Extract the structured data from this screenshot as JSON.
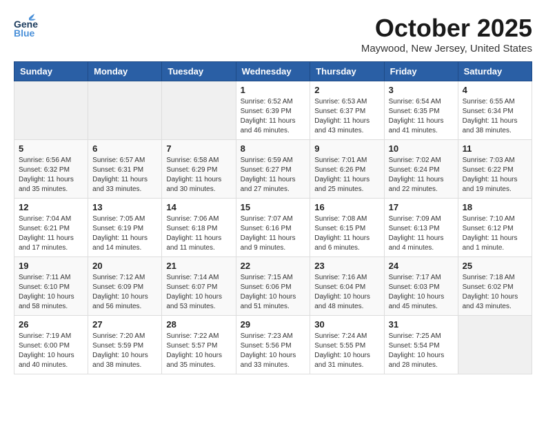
{
  "header": {
    "logo_general": "General",
    "logo_blue": "Blue",
    "month": "October 2025",
    "location": "Maywood, New Jersey, United States"
  },
  "weekdays": [
    "Sunday",
    "Monday",
    "Tuesday",
    "Wednesday",
    "Thursday",
    "Friday",
    "Saturday"
  ],
  "weeks": [
    [
      {
        "day": "",
        "info": ""
      },
      {
        "day": "",
        "info": ""
      },
      {
        "day": "",
        "info": ""
      },
      {
        "day": "1",
        "info": "Sunrise: 6:52 AM\nSunset: 6:39 PM\nDaylight: 11 hours\nand 46 minutes."
      },
      {
        "day": "2",
        "info": "Sunrise: 6:53 AM\nSunset: 6:37 PM\nDaylight: 11 hours\nand 43 minutes."
      },
      {
        "day": "3",
        "info": "Sunrise: 6:54 AM\nSunset: 6:35 PM\nDaylight: 11 hours\nand 41 minutes."
      },
      {
        "day": "4",
        "info": "Sunrise: 6:55 AM\nSunset: 6:34 PM\nDaylight: 11 hours\nand 38 minutes."
      }
    ],
    [
      {
        "day": "5",
        "info": "Sunrise: 6:56 AM\nSunset: 6:32 PM\nDaylight: 11 hours\nand 35 minutes."
      },
      {
        "day": "6",
        "info": "Sunrise: 6:57 AM\nSunset: 6:31 PM\nDaylight: 11 hours\nand 33 minutes."
      },
      {
        "day": "7",
        "info": "Sunrise: 6:58 AM\nSunset: 6:29 PM\nDaylight: 11 hours\nand 30 minutes."
      },
      {
        "day": "8",
        "info": "Sunrise: 6:59 AM\nSunset: 6:27 PM\nDaylight: 11 hours\nand 27 minutes."
      },
      {
        "day": "9",
        "info": "Sunrise: 7:01 AM\nSunset: 6:26 PM\nDaylight: 11 hours\nand 25 minutes."
      },
      {
        "day": "10",
        "info": "Sunrise: 7:02 AM\nSunset: 6:24 PM\nDaylight: 11 hours\nand 22 minutes."
      },
      {
        "day": "11",
        "info": "Sunrise: 7:03 AM\nSunset: 6:22 PM\nDaylight: 11 hours\nand 19 minutes."
      }
    ],
    [
      {
        "day": "12",
        "info": "Sunrise: 7:04 AM\nSunset: 6:21 PM\nDaylight: 11 hours\nand 17 minutes."
      },
      {
        "day": "13",
        "info": "Sunrise: 7:05 AM\nSunset: 6:19 PM\nDaylight: 11 hours\nand 14 minutes."
      },
      {
        "day": "14",
        "info": "Sunrise: 7:06 AM\nSunset: 6:18 PM\nDaylight: 11 hours\nand 11 minutes."
      },
      {
        "day": "15",
        "info": "Sunrise: 7:07 AM\nSunset: 6:16 PM\nDaylight: 11 hours\nand 9 minutes."
      },
      {
        "day": "16",
        "info": "Sunrise: 7:08 AM\nSunset: 6:15 PM\nDaylight: 11 hours\nand 6 minutes."
      },
      {
        "day": "17",
        "info": "Sunrise: 7:09 AM\nSunset: 6:13 PM\nDaylight: 11 hours\nand 4 minutes."
      },
      {
        "day": "18",
        "info": "Sunrise: 7:10 AM\nSunset: 6:12 PM\nDaylight: 11 hours\nand 1 minute."
      }
    ],
    [
      {
        "day": "19",
        "info": "Sunrise: 7:11 AM\nSunset: 6:10 PM\nDaylight: 10 hours\nand 58 minutes."
      },
      {
        "day": "20",
        "info": "Sunrise: 7:12 AM\nSunset: 6:09 PM\nDaylight: 10 hours\nand 56 minutes."
      },
      {
        "day": "21",
        "info": "Sunrise: 7:14 AM\nSunset: 6:07 PM\nDaylight: 10 hours\nand 53 minutes."
      },
      {
        "day": "22",
        "info": "Sunrise: 7:15 AM\nSunset: 6:06 PM\nDaylight: 10 hours\nand 51 minutes."
      },
      {
        "day": "23",
        "info": "Sunrise: 7:16 AM\nSunset: 6:04 PM\nDaylight: 10 hours\nand 48 minutes."
      },
      {
        "day": "24",
        "info": "Sunrise: 7:17 AM\nSunset: 6:03 PM\nDaylight: 10 hours\nand 45 minutes."
      },
      {
        "day": "25",
        "info": "Sunrise: 7:18 AM\nSunset: 6:02 PM\nDaylight: 10 hours\nand 43 minutes."
      }
    ],
    [
      {
        "day": "26",
        "info": "Sunrise: 7:19 AM\nSunset: 6:00 PM\nDaylight: 10 hours\nand 40 minutes."
      },
      {
        "day": "27",
        "info": "Sunrise: 7:20 AM\nSunset: 5:59 PM\nDaylight: 10 hours\nand 38 minutes."
      },
      {
        "day": "28",
        "info": "Sunrise: 7:22 AM\nSunset: 5:57 PM\nDaylight: 10 hours\nand 35 minutes."
      },
      {
        "day": "29",
        "info": "Sunrise: 7:23 AM\nSunset: 5:56 PM\nDaylight: 10 hours\nand 33 minutes."
      },
      {
        "day": "30",
        "info": "Sunrise: 7:24 AM\nSunset: 5:55 PM\nDaylight: 10 hours\nand 31 minutes."
      },
      {
        "day": "31",
        "info": "Sunrise: 7:25 AM\nSunset: 5:54 PM\nDaylight: 10 hours\nand 28 minutes."
      },
      {
        "day": "",
        "info": ""
      }
    ]
  ]
}
